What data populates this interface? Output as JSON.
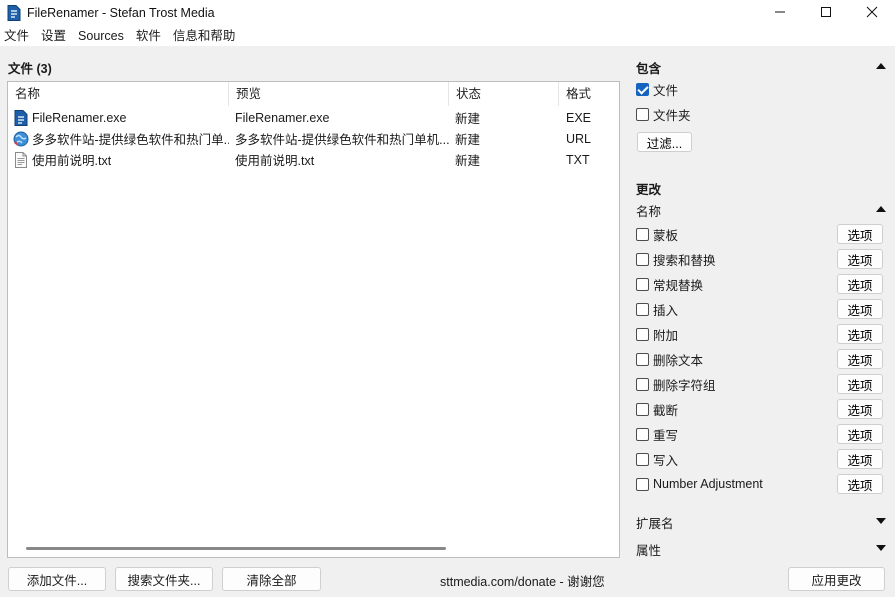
{
  "window": {
    "title": "FileRenamer - Stefan Trost Media"
  },
  "menu": [
    "文件",
    "设置",
    "Sources",
    "软件",
    "信息和帮助"
  ],
  "files_panel": {
    "label": "文件 (3)",
    "columns": [
      "名称",
      "预览",
      "状态",
      "格式"
    ],
    "rows": [
      {
        "name": "FileRenamer.exe",
        "preview": "FileRenamer.exe",
        "status": "新建",
        "format": "EXE",
        "icon": "exe-file-icon"
      },
      {
        "name": "多多软件站-提供绿色软件和热门单...",
        "preview": "多多软件站-提供绿色软件和热门单机...",
        "status": "新建",
        "format": "URL",
        "icon": "url-file-icon"
      },
      {
        "name": "使用前说明.txt",
        "preview": "使用前说明.txt",
        "status": "新建",
        "format": "TXT",
        "icon": "txt-file-icon"
      }
    ]
  },
  "bottom": {
    "add_files": "添加文件...",
    "search_folder": "搜索文件夹...",
    "clear_all": "清除全部",
    "donate": "sttmedia.com/donate - 谢谢您",
    "apply": "应用更改"
  },
  "sidebar": {
    "include_title": "包含",
    "include_files": "文件",
    "include_folders": "文件夹",
    "filter_button": "过滤...",
    "changes_title": "更改",
    "name_section": "名称",
    "option_label": "选项",
    "name_options": [
      "蒙板",
      "搜索和替换",
      "常规替换",
      "插入",
      "附加",
      "删除文本",
      "删除字符组",
      "截断",
      "重写",
      "写入",
      "Number Adjustment"
    ],
    "extension_section": "扩展名",
    "attributes_section": "属性"
  }
}
